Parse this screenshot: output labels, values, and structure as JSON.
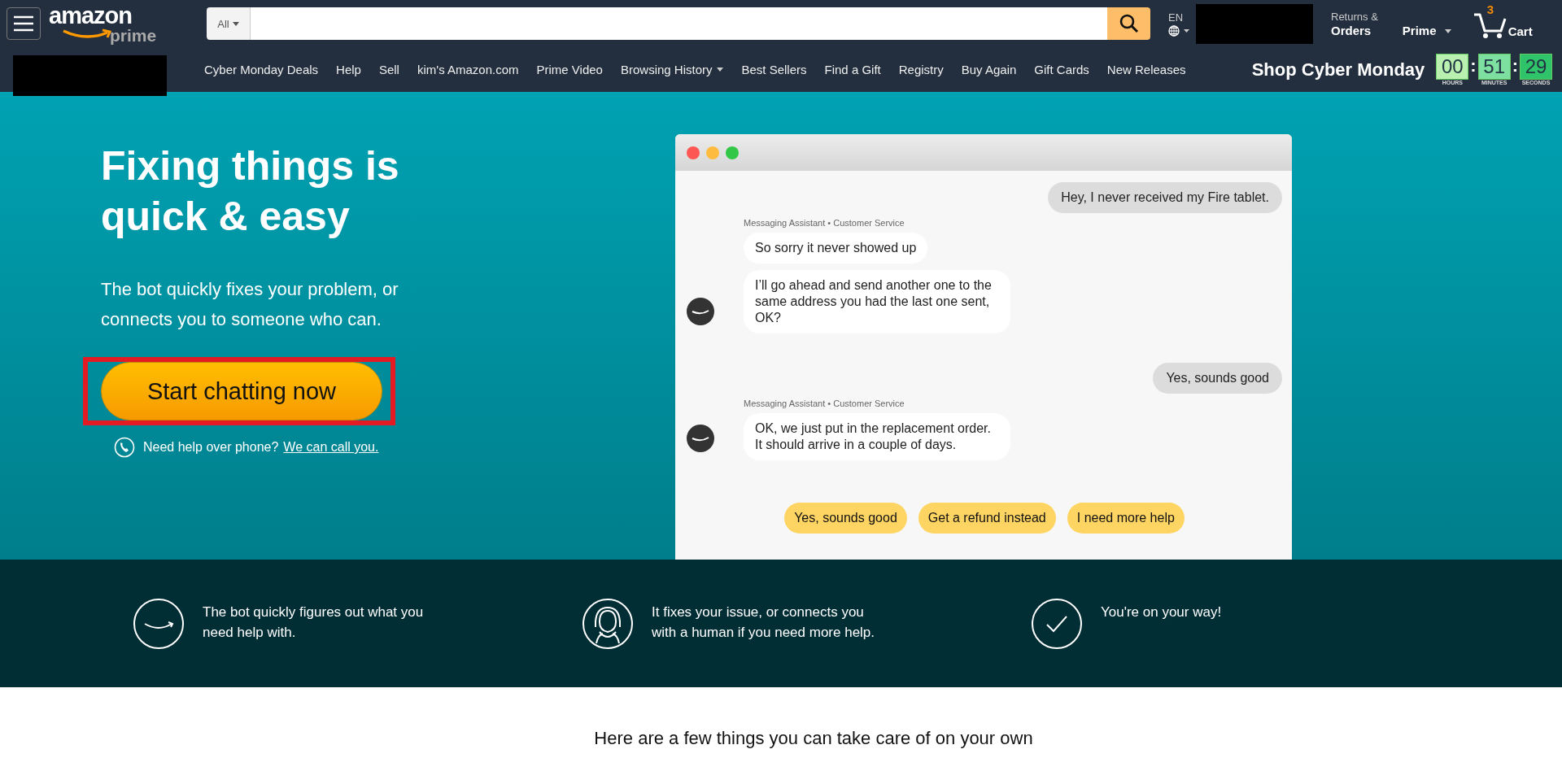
{
  "header": {
    "logo": {
      "wordmark": "amazon",
      "sub": "prime"
    },
    "search": {
      "category": "All"
    },
    "language": "EN",
    "returns": {
      "line1": "Returns &",
      "line2": "Orders"
    },
    "prime": "Prime",
    "cart": {
      "count": "3",
      "label": "Cart"
    }
  },
  "nav": {
    "items": [
      {
        "label": "Cyber Monday Deals",
        "dropdown": false
      },
      {
        "label": "Help",
        "dropdown": false
      },
      {
        "label": "Sell",
        "dropdown": false
      },
      {
        "label": "kim's Amazon.com",
        "dropdown": false
      },
      {
        "label": "Prime Video",
        "dropdown": false
      },
      {
        "label": "Browsing History",
        "dropdown": true
      },
      {
        "label": "Best Sellers",
        "dropdown": false
      },
      {
        "label": "Find a Gift",
        "dropdown": false
      },
      {
        "label": "Registry",
        "dropdown": false
      },
      {
        "label": "Buy Again",
        "dropdown": false
      },
      {
        "label": "Gift Cards",
        "dropdown": false
      },
      {
        "label": "New Releases",
        "dropdown": false
      }
    ],
    "promo": "Shop Cyber Monday",
    "countdown_separator": ":",
    "countdown": [
      {
        "value": "00",
        "unit": "HOURS",
        "color": "#b9f0b0"
      },
      {
        "value": "51",
        "unit": "MINUTES",
        "color": "#7ee0a0"
      },
      {
        "value": "29",
        "unit": "SECONDS",
        "color": "#2fc46a"
      }
    ]
  },
  "hero": {
    "title": "Fixing things is quick & easy",
    "subtitle": "The bot quickly fixes your problem, or connects you to someone who can.",
    "cta": "Start chatting now",
    "phone_text": "Need help over phone?",
    "phone_link": "We can call you."
  },
  "chat": {
    "messages": [
      {
        "kind": "user",
        "text": "Hey, I never received my Fire tablet."
      },
      {
        "kind": "bot",
        "sender": "Messaging Assistant • Customer Service",
        "texts": [
          "So sorry it never showed up",
          "I’ll go ahead and send another one to the same address you had the last one sent, OK?"
        ]
      },
      {
        "kind": "user",
        "text": "Yes, sounds good"
      },
      {
        "kind": "bot",
        "sender": "Messaging Assistant • Customer Service",
        "texts": [
          "OK, we just put in the replacement order. It should arrive in a couple of days."
        ]
      }
    ],
    "quick_replies": [
      "Yes, sounds good",
      "Get a refund instead",
      "I need more help"
    ]
  },
  "steps": [
    {
      "kind": "smile",
      "text": "The bot quickly figures out what you need help with."
    },
    {
      "kind": "headset",
      "text": "It fixes your issue, or connects you with a human if you need more help."
    },
    {
      "kind": "check",
      "text": "You're on your way!"
    }
  ],
  "section_heading": "Here are a few things you can take care of on your own"
}
